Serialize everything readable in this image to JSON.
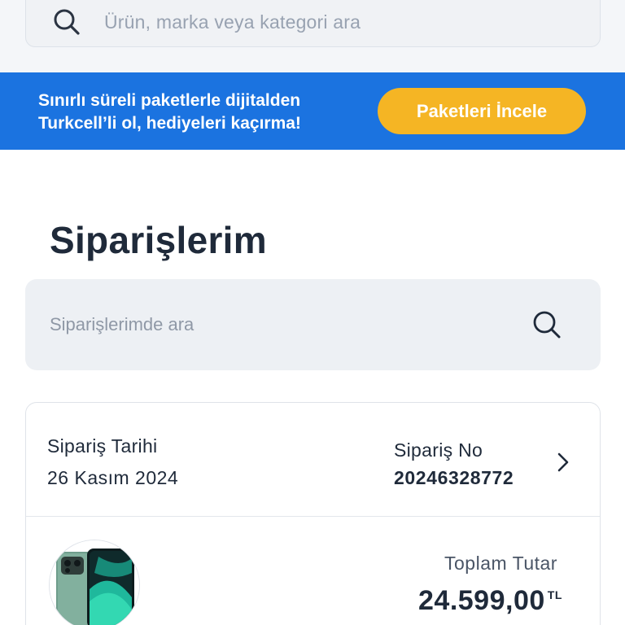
{
  "search": {
    "placeholder": "Ürün, marka veya kategori ara"
  },
  "banner": {
    "line1": "Sınırlı süreli paketlerle dijitalden",
    "line2": "Turkcell’li ol, hediyeleri kaçırma!",
    "button_label": "Paketleri İncele",
    "background_color": "#1b73e0",
    "button_color": "#f5b524"
  },
  "page": {
    "title": "Siparişlerim"
  },
  "order_search": {
    "placeholder": "Siparişlerimde ara"
  },
  "order": {
    "date_label": "Sipariş Tarihi",
    "date_value": "26 Kasım 2024",
    "number_label": "Sipariş No",
    "number_value": "20246328772",
    "total_label": "Toplam Tutar",
    "total_value": "24.599,00",
    "currency": "TL",
    "product_image": "green-smartphone"
  },
  "icons": [
    "search-icon",
    "chevron-right-icon"
  ]
}
